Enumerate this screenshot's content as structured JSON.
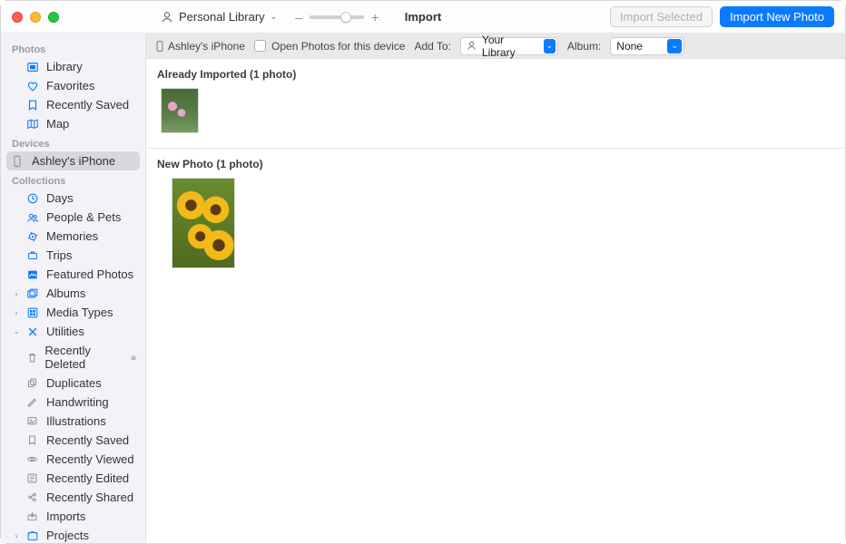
{
  "window": {
    "title": "Import",
    "library_label": "Personal Library",
    "import_selected": "Import Selected",
    "import_new": "Import New Photo",
    "zoom_minus": "–",
    "zoom_plus": "+"
  },
  "toolbar": {
    "device_name": "Ashley's iPhone",
    "open_photos_label": "Open Photos for this device",
    "add_to_label": "Add To:",
    "add_to_value": "Your Library",
    "album_label": "Album:",
    "album_value": "None"
  },
  "sections": {
    "already_imported": "Already Imported (1 photo)",
    "new_photo": "New Photo (1 photo)"
  },
  "sidebar": {
    "photos_head": "Photos",
    "library": "Library",
    "favorites": "Favorites",
    "recently_saved": "Recently Saved",
    "map": "Map",
    "devices_head": "Devices",
    "device_item": "Ashley's iPhone",
    "collections_head": "Collections",
    "days": "Days",
    "people_pets": "People & Pets",
    "memories": "Memories",
    "trips": "Trips",
    "featured_photos": "Featured Photos",
    "albums": "Albums",
    "media_types": "Media Types",
    "utilities": "Utilities",
    "recently_deleted": "Recently Deleted",
    "duplicates": "Duplicates",
    "handwriting": "Handwriting",
    "illustrations": "Illustrations",
    "recently_saved2": "Recently Saved",
    "recently_viewed": "Recently Viewed",
    "recently_edited": "Recently Edited",
    "recently_shared": "Recently Shared",
    "imports": "Imports",
    "projects": "Projects"
  }
}
